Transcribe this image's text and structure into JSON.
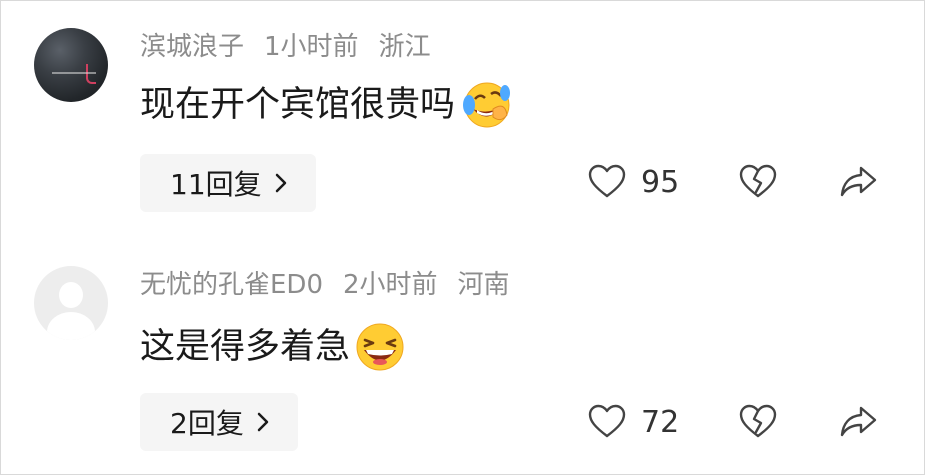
{
  "comments": [
    {
      "username": "滨城浪子",
      "time": "1小时前",
      "location": "浙江",
      "text": "现在开个宾馆很贵吗",
      "emoji": "rolling-laughing-emoji",
      "reply_label": "11回复",
      "likes": "95",
      "avatar": "dark-photo-avatar"
    },
    {
      "username": "无忧的孔雀ED0",
      "time": "2小时前",
      "location": "河南",
      "text": "这是得多着急",
      "emoji": "grinning-squint-emoji",
      "reply_label": "2回复",
      "likes": "72",
      "avatar": "default-gray-avatar"
    }
  ],
  "icons": {
    "like": "heart-outline-icon",
    "dislike": "broken-heart-icon",
    "share": "share-arrow-icon",
    "reply_chevron": "chevron-right-icon"
  },
  "colors": {
    "meta_text": "#8c8c8c",
    "body_text": "#1a1a1a",
    "reply_bg": "#f5f5f5",
    "icon": "#444444",
    "emoji_yellow": "#ffcc33"
  }
}
